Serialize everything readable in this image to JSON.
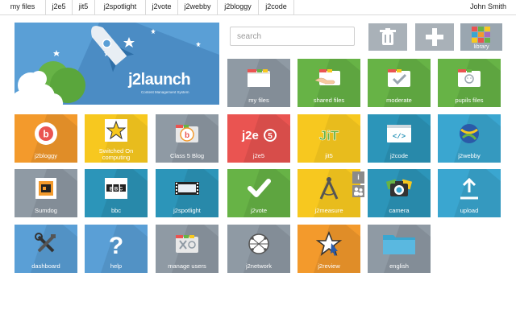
{
  "nav": {
    "items": [
      "my files",
      "j2e5",
      "jit5",
      "j2spotlight",
      "j2vote",
      "j2webby",
      "j2bloggy",
      "j2code"
    ],
    "user": "John Smith"
  },
  "banner": {
    "title": "j2launch",
    "subtitle": "Content Management System"
  },
  "search": {
    "placeholder": "search"
  },
  "toolbar": {
    "library_label": "library"
  },
  "tiles": {
    "my_files": "my files",
    "shared_files": "shared files",
    "moderate": "moderate",
    "pupils_files": "pupils files",
    "j2bloggy": "j2bloggy",
    "switched_on_1": "Switched On",
    "switched_on_2": "computing",
    "class5blog": "Class 5 Blog",
    "j2e5": "j2e5",
    "jit5": "jit5",
    "j2code": "j2code",
    "j2webby": "j2webby",
    "sumdog": "Sumdog",
    "bbc": "bbc",
    "j2spotlight": "j2spotlight",
    "j2vote": "j2vote",
    "j2measure": "j2measure",
    "camera": "camera",
    "upload": "upload",
    "dashboard": "dashboard",
    "help": "help",
    "manage_users": "manage users",
    "j2network": "j2network",
    "j2review": "j2review",
    "english": "english"
  },
  "icon_text": {
    "j2e5": "j2e",
    "j2e5_num": "5",
    "jit": "JiT",
    "bbc": "B B C",
    "help": "?"
  },
  "colors": {
    "gray": "#8f9aa4",
    "green": "#67b346",
    "blue_light": "#3aa6d0",
    "blue": "#5a9fd6",
    "orange": "#f39a2c",
    "yellow": "#f7c81f",
    "red": "#ea5451",
    "teal": "#2c95b9"
  }
}
